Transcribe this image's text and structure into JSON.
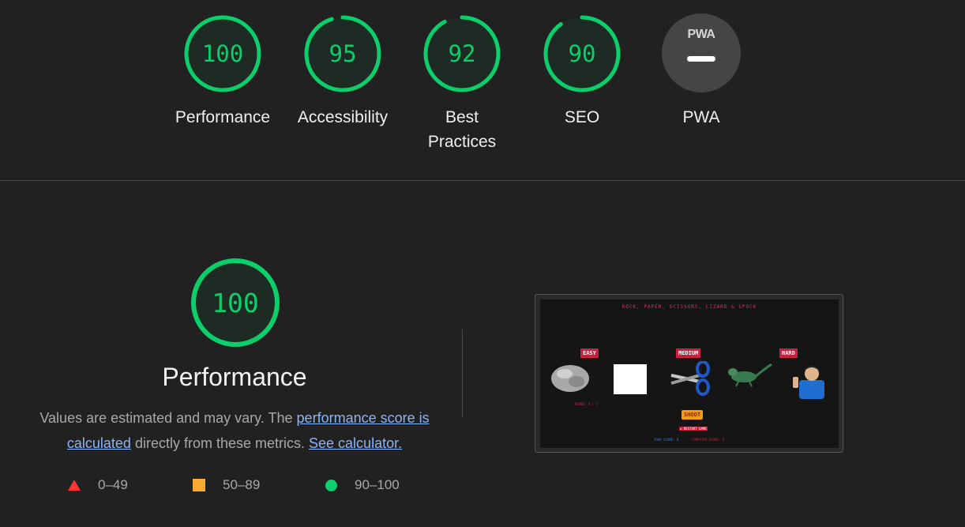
{
  "gauges": [
    {
      "score": "100",
      "label": "Performance",
      "fraction": 1.0
    },
    {
      "score": "95",
      "label": "Accessibility",
      "fraction": 0.95
    },
    {
      "score": "92",
      "label": "Best Practices",
      "fraction": 0.92
    },
    {
      "score": "90",
      "label": "SEO",
      "fraction": 0.9
    }
  ],
  "pwa": {
    "logo_text": "PWA",
    "label": "PWA"
  },
  "performance": {
    "score": "100",
    "fraction": 1.0,
    "title": "Performance",
    "desc_prefix": "Values are estimated and may vary. The ",
    "desc_link1": "performance score is calculated",
    "desc_middle": " directly from these metrics. ",
    "desc_link2": "See calculator."
  },
  "legend": [
    {
      "icon": "triangle-icon",
      "range": "0–49",
      "color": "#ff3333"
    },
    {
      "icon": "square-icon",
      "range": "50–89",
      "color": "#ffaa33"
    },
    {
      "icon": "circle-icon",
      "range": "90–100",
      "color": "#0cce6b"
    }
  ],
  "colors": {
    "pass": "#0cce6b",
    "gauge_bg": "#1e2b24",
    "background": "#212121"
  },
  "screenshot": {
    "title": "ROCK, PAPER, SCISSORS, LIZARD & SPOCK",
    "levels": [
      "EASY",
      "MEDIUM",
      "HARD"
    ],
    "round_text": "ROUND: 0 / 5",
    "shoot": "SHOOT",
    "reset": "↺ RESTART GAME",
    "your_score": "YOUR SCORE: 0",
    "computer_score": "COMPUTER SCORE: 0"
  }
}
